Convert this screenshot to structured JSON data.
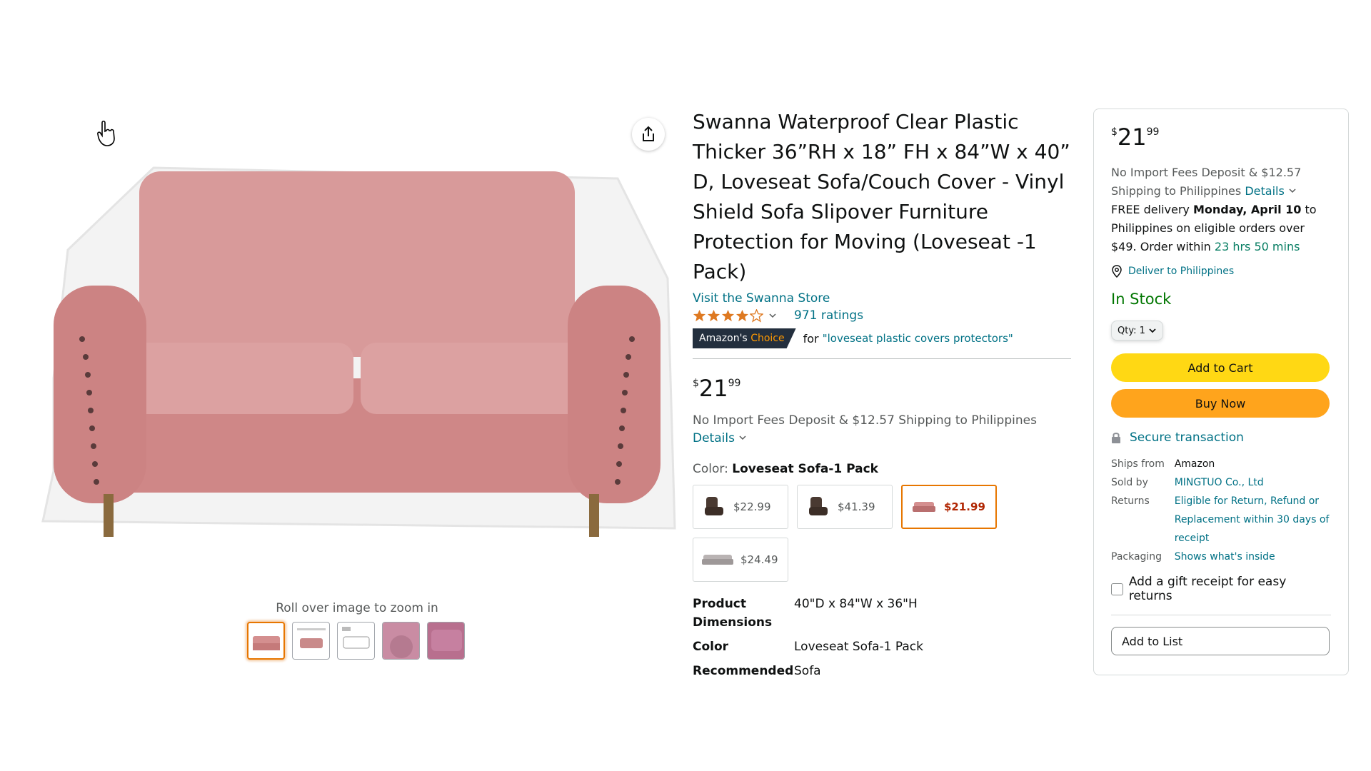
{
  "gallery": {
    "zoom_hint": "Roll over image to zoom in",
    "thumbnails": [
      "thumb-sofa-pink",
      "thumb-sofa-diagram",
      "thumb-sofa-sketch",
      "thumb-closeup-pink",
      "thumb-closeup-fabric"
    ]
  },
  "product": {
    "title": "Swanna Waterproof Clear Plastic Thicker 36”RH x 18” FH x 84”W x 40” D, Loveseat Sofa/Couch Cover - Vinyl Shield Sofa Slipover Furniture Protection for Moving (Loveseat -1 Pack)",
    "store_link": "Visit the Swanna Store",
    "rating": 4.1,
    "ratings_count": "971 ratings",
    "badge_prefix": "Amazon's",
    "badge_choice": "Choice",
    "badge_for": "for",
    "badge_query": "\"loveseat plastic covers protectors\"",
    "price_symbol": "$",
    "price_whole": "21",
    "price_fraction": "99",
    "shipping_text": "No Import Fees Deposit & $12.57 Shipping to Philippines",
    "details_link": "Details",
    "color_label": "Color:",
    "color_value": "Loveseat Sofa-1 Pack",
    "swatches": [
      {
        "price": "$22.99",
        "selected": false
      },
      {
        "price": "$41.39",
        "selected": false
      },
      {
        "price": "$21.99",
        "selected": true
      },
      {
        "price": "$24.49",
        "selected": false
      }
    ],
    "specs": [
      {
        "key": "Product Dimensions",
        "value": "40\"D x 84\"W x 36\"H"
      },
      {
        "key": "Color",
        "value": "Loveseat Sofa-1 Pack"
      },
      {
        "key": "Recommended",
        "value": "Sofa"
      }
    ]
  },
  "buybox": {
    "price_symbol": "$",
    "price_whole": "21",
    "price_fraction": "99",
    "shipping_text": "No Import Fees Deposit & $12.57 Shipping to Philippines",
    "details_link": "Details",
    "delivery_prefix": "FREE delivery",
    "delivery_date": "Monday, April 10",
    "delivery_suffix": "to Philippines on eligible orders over $49. Order within",
    "countdown": "23 hrs 50 mins",
    "deliver_to": "Deliver to Philippines",
    "stock": "In Stock",
    "qty_label": "Qty: 1",
    "add_to_cart": "Add to Cart",
    "buy_now": "Buy Now",
    "secure": "Secure transaction",
    "info": {
      "ships_from_label": "Ships from",
      "ships_from": "Amazon",
      "sold_by_label": "Sold by",
      "sold_by": "MINGTUO Co., Ltd",
      "returns_label": "Returns",
      "returns": "Eligible for Return, Refund or Replacement within 30 days of receipt",
      "packaging_label": "Packaging",
      "packaging": "Shows what's inside"
    },
    "gift_receipt": "Add a gift receipt for easy returns",
    "add_to_list": "Add to List"
  },
  "colors": {
    "link": "#007185",
    "cart_button": "#ffd814",
    "buy_button": "#ffa41c",
    "stock": "#007600",
    "selected_border": "#e77600",
    "sofa": "#d48f8f"
  }
}
